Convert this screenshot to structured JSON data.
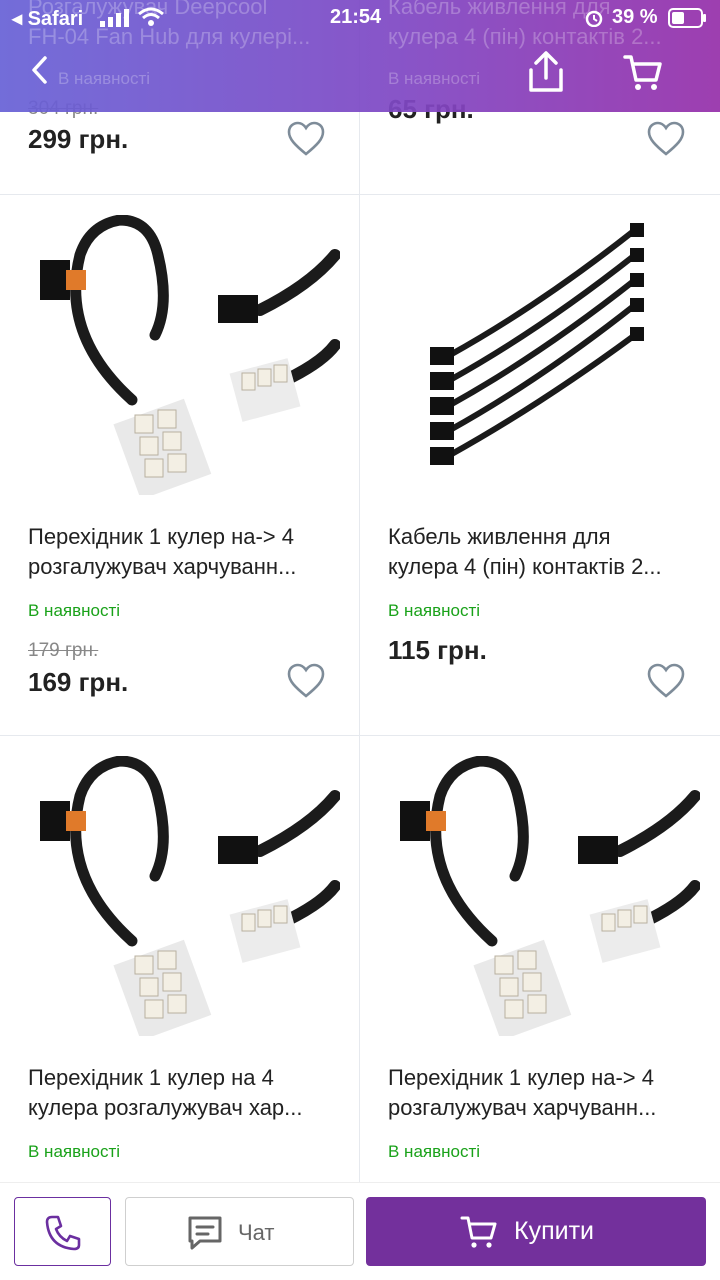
{
  "status_bar": {
    "carrier": "◂ Safari",
    "time": "21:54",
    "battery": "39 %"
  },
  "header": {
    "back_label": "‹",
    "behind_text": {
      "left_line1": "Розгалужувач Deepcool",
      "left_line2": "FH-04 Fan Hub для кулері...",
      "left_stock": "В наявності",
      "right_line1": "Кабель живлення для",
      "right_line2": "кулера 4 (пін) контактів 2...",
      "right_stock": "В наявності"
    }
  },
  "products_top": [
    {
      "old_price": "304 грн.",
      "price": "299 грн."
    },
    {
      "old_price": "",
      "price": "65 грн."
    }
  ],
  "products": [
    {
      "title_line1": "Перехідник 1 кулер на-> 4",
      "title_line2": "розгалужувач харчуванн...",
      "stock": "В наявності",
      "old_price": "179 грн.",
      "price": "169 грн."
    },
    {
      "title_line1": "Кабель живлення для",
      "title_line2": "кулера 4 (пін) контактів 2...",
      "stock": "В наявності",
      "old_price": "",
      "price": "115 грн."
    },
    {
      "title_line1": "Перехідник 1 кулер на 4",
      "title_line2": "кулера розгалужувач хар...",
      "stock": "В наявності",
      "old_price": "",
      "price": ""
    },
    {
      "title_line1": "Перехідник 1 кулер на-> 4",
      "title_line2": "розгалужувач харчуванн...",
      "stock": "В наявності",
      "old_price": "",
      "price": ""
    }
  ],
  "bottom_bar": {
    "chat_label": "Чат",
    "buy_label": "Купити"
  },
  "colors": {
    "accent": "#73309c",
    "stock_green": "#1aa21a",
    "header_start": "#6862d6",
    "header_end": "#9630aa"
  },
  "icons": {
    "back": "chevron-left-icon",
    "share": "share-icon",
    "cart": "cart-icon",
    "favorite": "heart-icon",
    "phone": "phone-icon",
    "chat": "chat-icon"
  }
}
